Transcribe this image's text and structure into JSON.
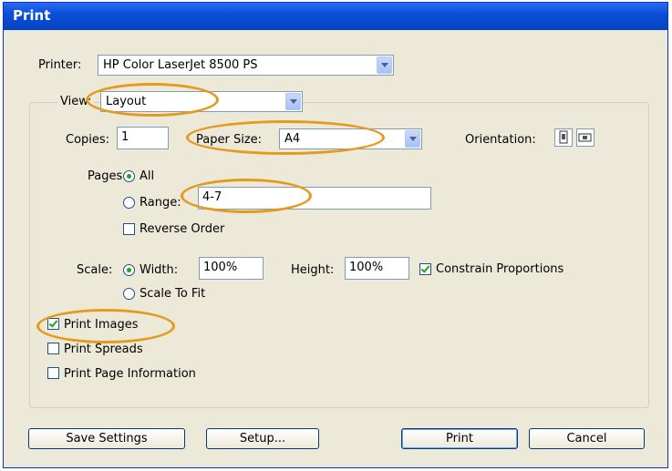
{
  "window": {
    "title": "Print"
  },
  "printer": {
    "label": "Printer:",
    "value": "HP Color LaserJet 8500 PS"
  },
  "view": {
    "label": "View:",
    "value": "Layout"
  },
  "copies": {
    "label": "Copies:",
    "value": "1"
  },
  "paper_size": {
    "label": "Paper Size:",
    "value": "A4"
  },
  "orientation": {
    "label": "Orientation:"
  },
  "pages": {
    "label": "Pages",
    "all_label": "All",
    "range_label": "Range:",
    "range_value": "4-7",
    "reverse_label": "Reverse Order"
  },
  "scale": {
    "label": "Scale:",
    "width_label": "Width:",
    "width_value": "100%",
    "height_label": "Height:",
    "height_value": "100%",
    "constrain_label": "Constrain Proportions",
    "fit_label": "Scale To Fit"
  },
  "options": {
    "print_images": "Print Images",
    "print_spreads": "Print Spreads",
    "print_page_info": "Print Page Information"
  },
  "buttons": {
    "save_settings": "Save Settings",
    "setup": "Setup...",
    "print": "Print",
    "cancel": "Cancel"
  },
  "colors": {
    "highlight_ring": "#e39a1d",
    "titlebar": "#0a4fd8",
    "dialog_bg": "#ece9d8"
  }
}
